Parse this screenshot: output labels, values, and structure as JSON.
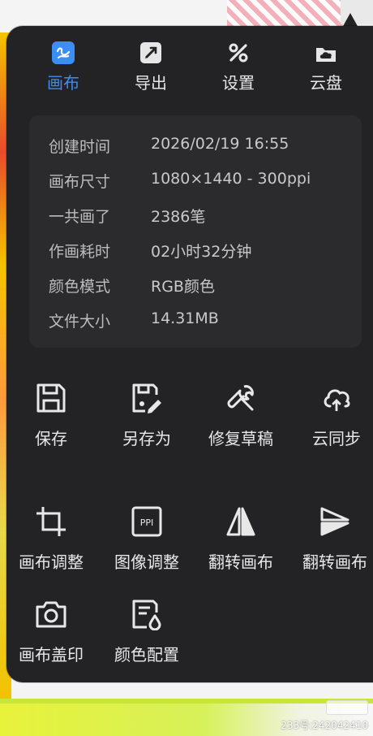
{
  "tabs": [
    {
      "label": "画布",
      "icon": "canvas-icon"
    },
    {
      "label": "导出",
      "icon": "export-icon"
    },
    {
      "label": "设置",
      "icon": "settings-icon"
    },
    {
      "label": "云盘",
      "icon": "cloud-drive-icon"
    }
  ],
  "info": {
    "created_label": "创建时间",
    "created_value": "2026/02/19 16:55",
    "size_label": "画布尺寸",
    "size_value": "1080×1440 - 300ppi",
    "strokes_label": "一共画了",
    "strokes_value": "2386笔",
    "time_label": "作画耗时",
    "time_value": "02小时32分钟",
    "color_label": "颜色模式",
    "color_value": "RGB颜色",
    "filesize_label": "文件大小",
    "filesize_value": "14.31MB"
  },
  "actions": [
    {
      "label": "保存",
      "icon": "save-icon"
    },
    {
      "label": "另存为",
      "icon": "save-as-icon"
    },
    {
      "label": "修复草稿",
      "icon": "repair-wrench-icon"
    },
    {
      "label": "云同步",
      "icon": "cloud-sync-icon"
    },
    {
      "label": "画布调整",
      "icon": "crop-icon"
    },
    {
      "label": "图像调整",
      "icon": "ppi-icon"
    },
    {
      "label": "翻转画布",
      "icon": "flip-horizontal-icon"
    },
    {
      "label": "翻转画布",
      "icon": "flip-vertical-icon"
    },
    {
      "label": "画布盖印",
      "icon": "camera-icon"
    },
    {
      "label": "颜色配置",
      "icon": "color-profile-icon"
    }
  ],
  "ppi_icon_text": "PPI",
  "watermark": "233号:242042410",
  "colors": {
    "accent": "#3a8ef5",
    "panel": "#232326",
    "card": "#2b2b2e"
  }
}
